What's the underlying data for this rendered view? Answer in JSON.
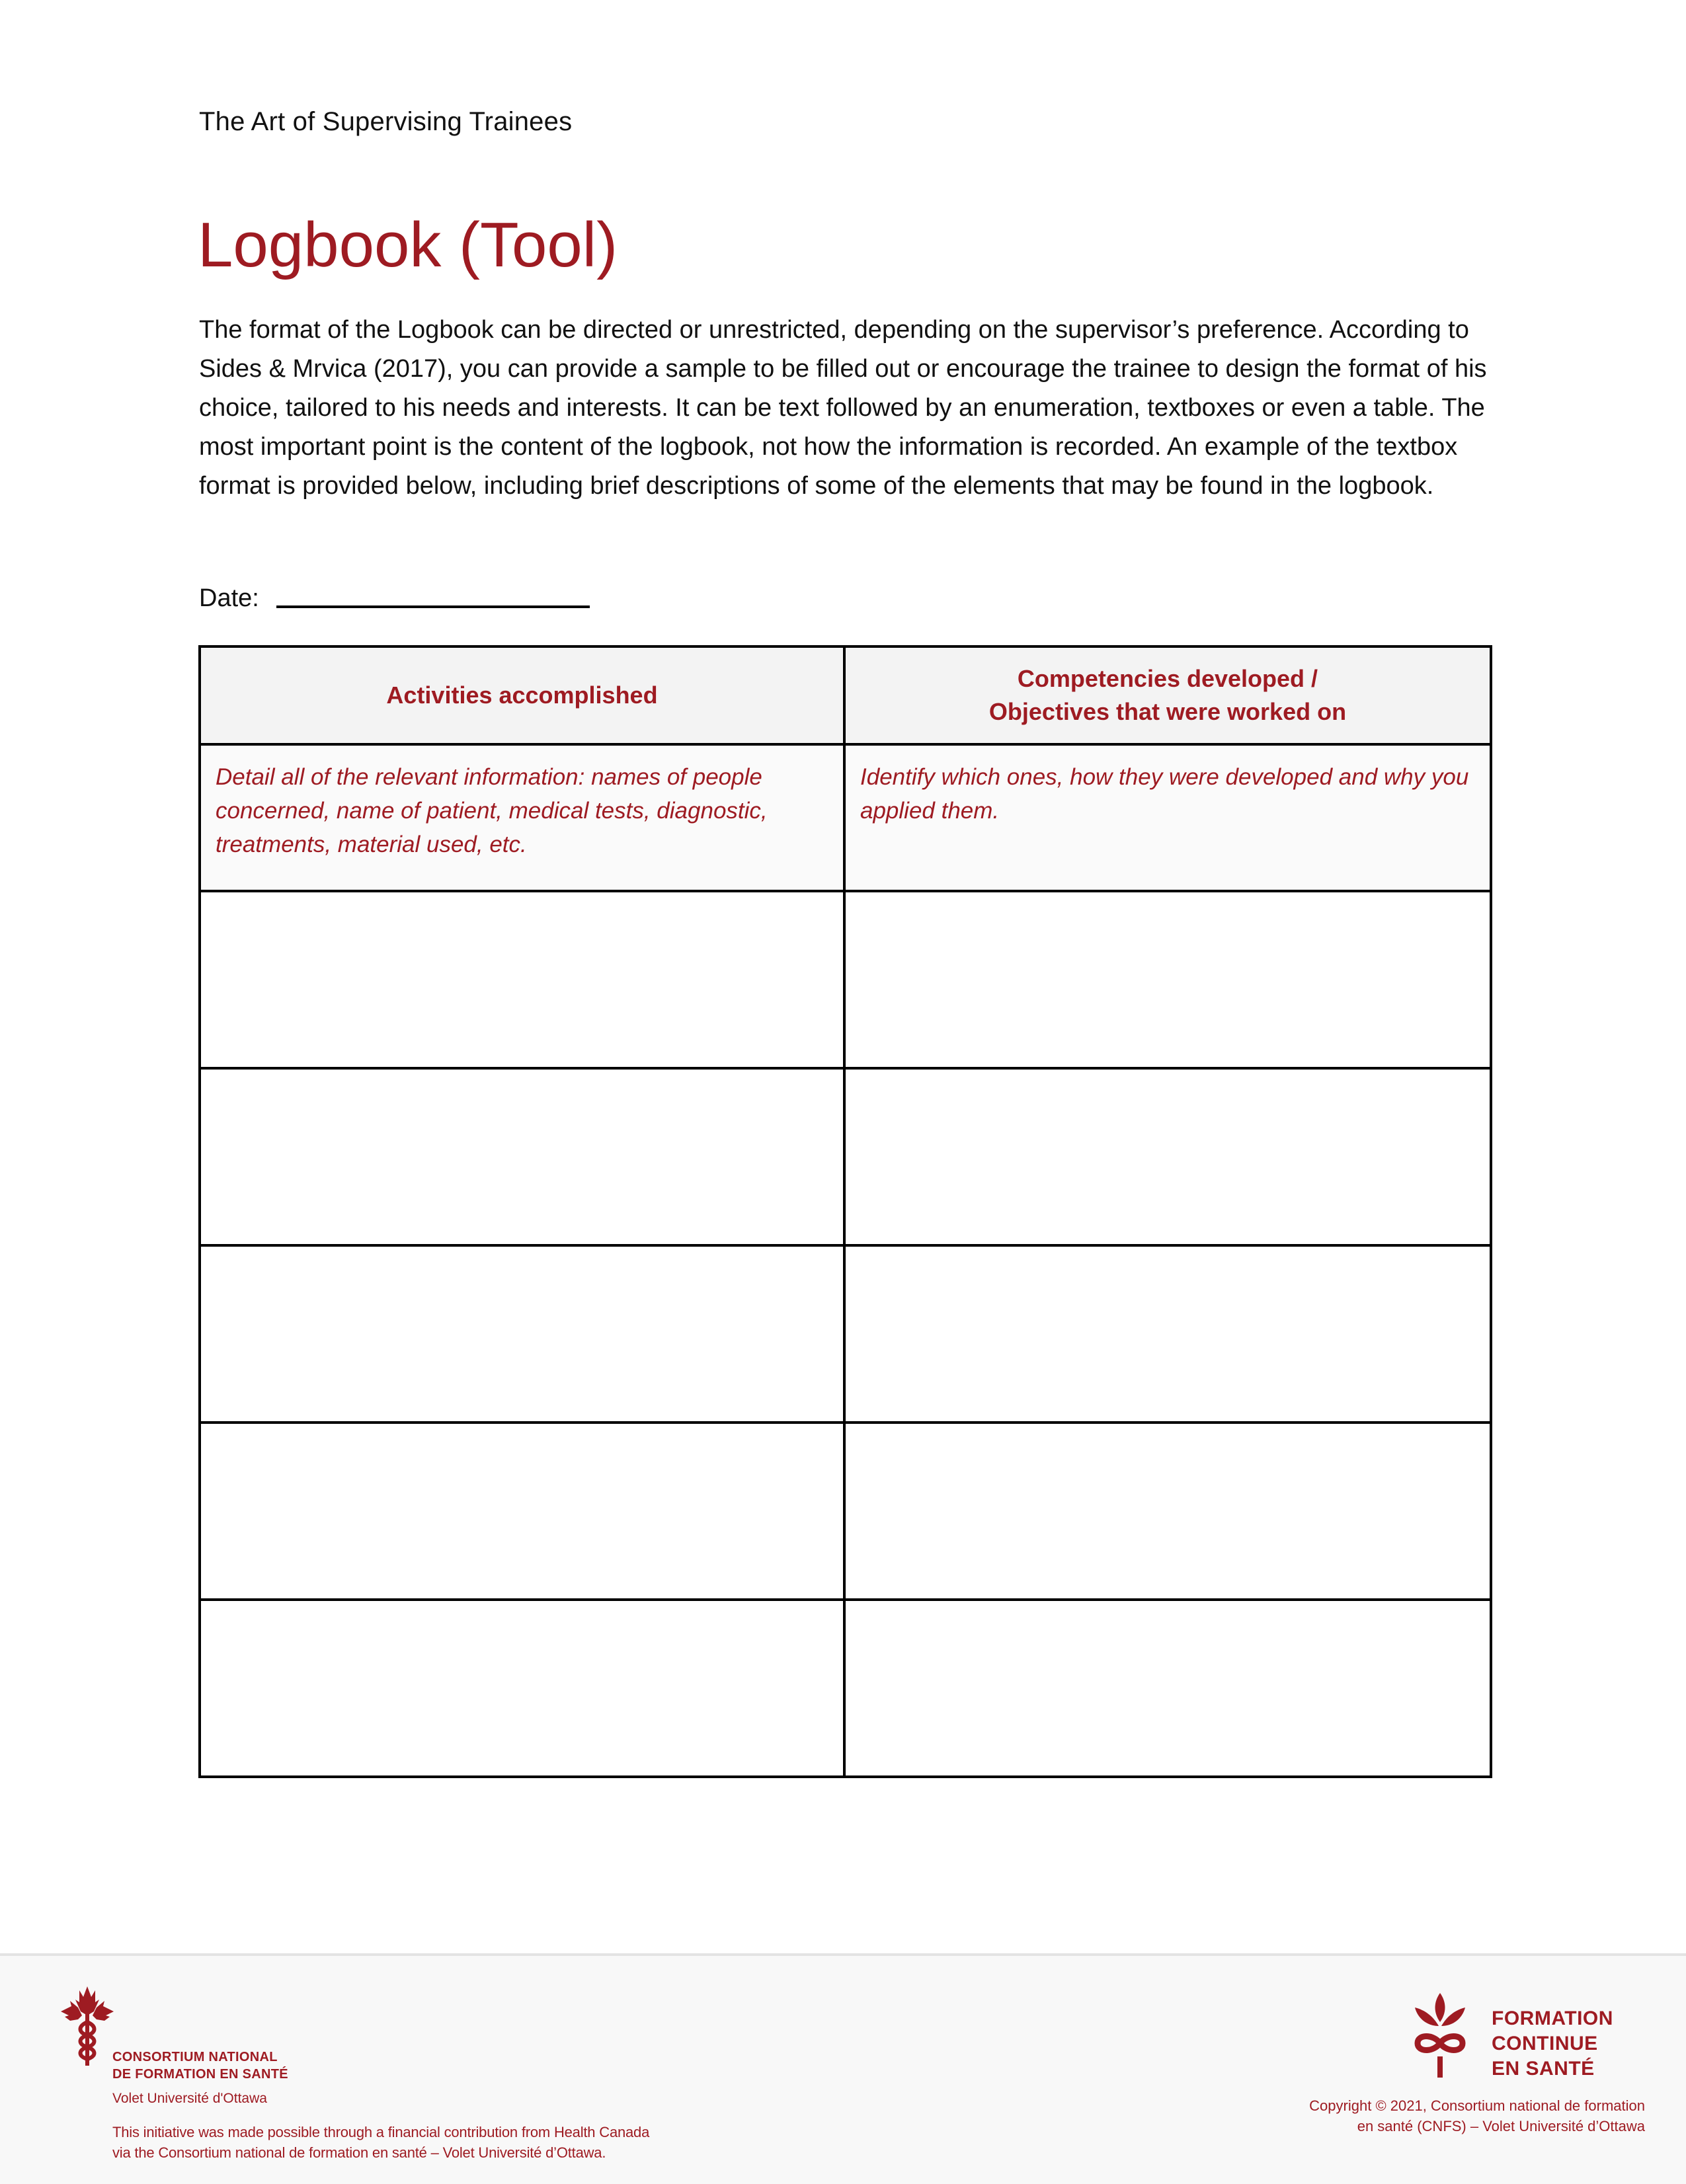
{
  "header": {
    "running_title": "The Art of Supervising Trainees"
  },
  "document": {
    "title": "Logbook (Tool)",
    "intro": "The format of the Logbook can be directed or unrestricted, depending on the supervisor’s preference. According to Sides & Mrvica (2017), you can provide a sample to be filled out or encourage the trainee to design the format of his choice, tailored to his needs and interests. It can be text followed by an enumeration, textboxes or even a table. The most important point is the content of the logbook, not how the information is recorded. An example of the textbox format is provided below, including brief descriptions of some of the elements that may be found in the logbook.",
    "date_label": "Date:",
    "date_value": ""
  },
  "table": {
    "columns": [
      {
        "header_lines": [
          "Activities accomplished"
        ]
      },
      {
        "header_lines": [
          "Competencies developed /",
          "Objectives that were worked on"
        ]
      }
    ],
    "guidance": [
      "Detail all of the relevant information: names of people concerned, name of patient, medical tests, diagnostic, treatments, material used, etc.",
      "Identify which ones, how they were developed and why you applied them."
    ],
    "blank_rows": 5
  },
  "footer": {
    "left_logo": {
      "icon": "maple-leaf-caduceus-icon",
      "name_lines": [
        "CONSORTIUM NATIONAL",
        "DE FORMATION EN SANTÉ"
      ],
      "subtitle": "Volet Université d'Ottawa"
    },
    "funding_lines": [
      "This initiative was made possible through a financial contribution from Health Canada",
      "via the Consortium national de formation en santé – Volet Université d’Ottawa."
    ],
    "right_logo": {
      "icon": "leaf-infinity-icon",
      "name_lines": [
        "FORMATION",
        "CONTINUE",
        "EN SANTÉ"
      ]
    },
    "copyright_lines": [
      "Copyright © 2021, Consortium national de formation",
      "en santé (CNFS) – Volet Université d’Ottawa"
    ]
  },
  "colors": {
    "accent_red": "#9e1b22",
    "header_fill": "#f3f3f3",
    "guidance_fill": "#fafafa",
    "footer_fill": "#f8f8f8"
  }
}
